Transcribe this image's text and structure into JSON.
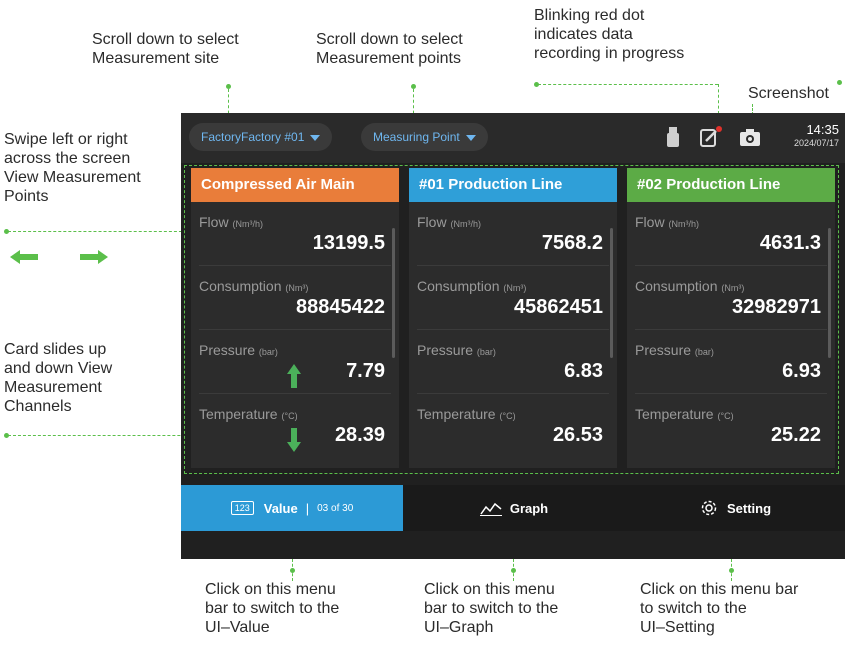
{
  "annotations": {
    "site": [
      "Scroll down to select",
      "Measurement site"
    ],
    "points": [
      "Scroll down to select",
      "Measurement points"
    ],
    "blink": [
      "Blinking red dot",
      "indicates data",
      "recording in progress"
    ],
    "screenshot": "Screenshot",
    "swipe": [
      "Swipe left or right",
      "across the screen",
      "View Measurement",
      "Points"
    ],
    "card_slides": [
      "Card slides up",
      "and down View",
      "Measurement",
      "Channels"
    ],
    "click_value": [
      "Click on this menu",
      "bar to switch to the",
      "UI–Value"
    ],
    "click_graph": [
      "Click on this menu",
      "bar to switch to the",
      "UI–Graph"
    ],
    "click_setting": [
      "Click on this menu bar",
      "to switch to the",
      "UI–Setting"
    ]
  },
  "topbar": {
    "site": "FactoryFactory #01",
    "point": "Measuring Point",
    "time": "14:35",
    "date": "2024/07/17"
  },
  "cards": [
    {
      "title": "Compressed Air Main",
      "color": "#e97d3a",
      "metrics": [
        {
          "label": "Flow",
          "unit": "(Nm³/h)",
          "value": "13199.5"
        },
        {
          "label": "Consumption",
          "unit": "(Nm³)",
          "value": "88845422"
        },
        {
          "label": "Pressure",
          "unit": "(bar)",
          "value": "7.79"
        },
        {
          "label": "Temperature",
          "unit": "(°C)",
          "value": "28.39"
        }
      ]
    },
    {
      "title": "#01 Production Line",
      "color": "#2f9fd8",
      "metrics": [
        {
          "label": "Flow",
          "unit": "(Nm³/h)",
          "value": "7568.2"
        },
        {
          "label": "Consumption",
          "unit": "(Nm³)",
          "value": "45862451"
        },
        {
          "label": "Pressure",
          "unit": "(bar)",
          "value": "6.83"
        },
        {
          "label": "Temperature",
          "unit": "(°C)",
          "value": "26.53"
        }
      ]
    },
    {
      "title": "#02 Production Line",
      "color": "#5cab46",
      "metrics": [
        {
          "label": "Flow",
          "unit": "(Nm³/h)",
          "value": "4631.3"
        },
        {
          "label": "Consumption",
          "unit": "(Nm³)",
          "value": "32982971"
        },
        {
          "label": "Pressure",
          "unit": "(bar)",
          "value": "6.93"
        },
        {
          "label": "Temperature",
          "unit": "(°C)",
          "value": "25.22"
        }
      ]
    }
  ],
  "menu": {
    "value_icon": "123",
    "value_label": "Value",
    "value_sep": "|",
    "value_count": "03 of 30",
    "graph_label": "Graph",
    "setting_label": "Setting"
  },
  "icons": [
    "usb-drive-icon",
    "recording-edit-icon",
    "camera-icon",
    "chart-line-icon",
    "gear-icon",
    "swipe-left-arrow-icon",
    "swipe-right-arrow-icon",
    "scroll-up-arrow-icon",
    "scroll-down-arrow-icon"
  ],
  "colors": {
    "accent": "#2c9ad6",
    "annotation_green": "#5bbf4a",
    "record_dot": "#e0312b"
  }
}
